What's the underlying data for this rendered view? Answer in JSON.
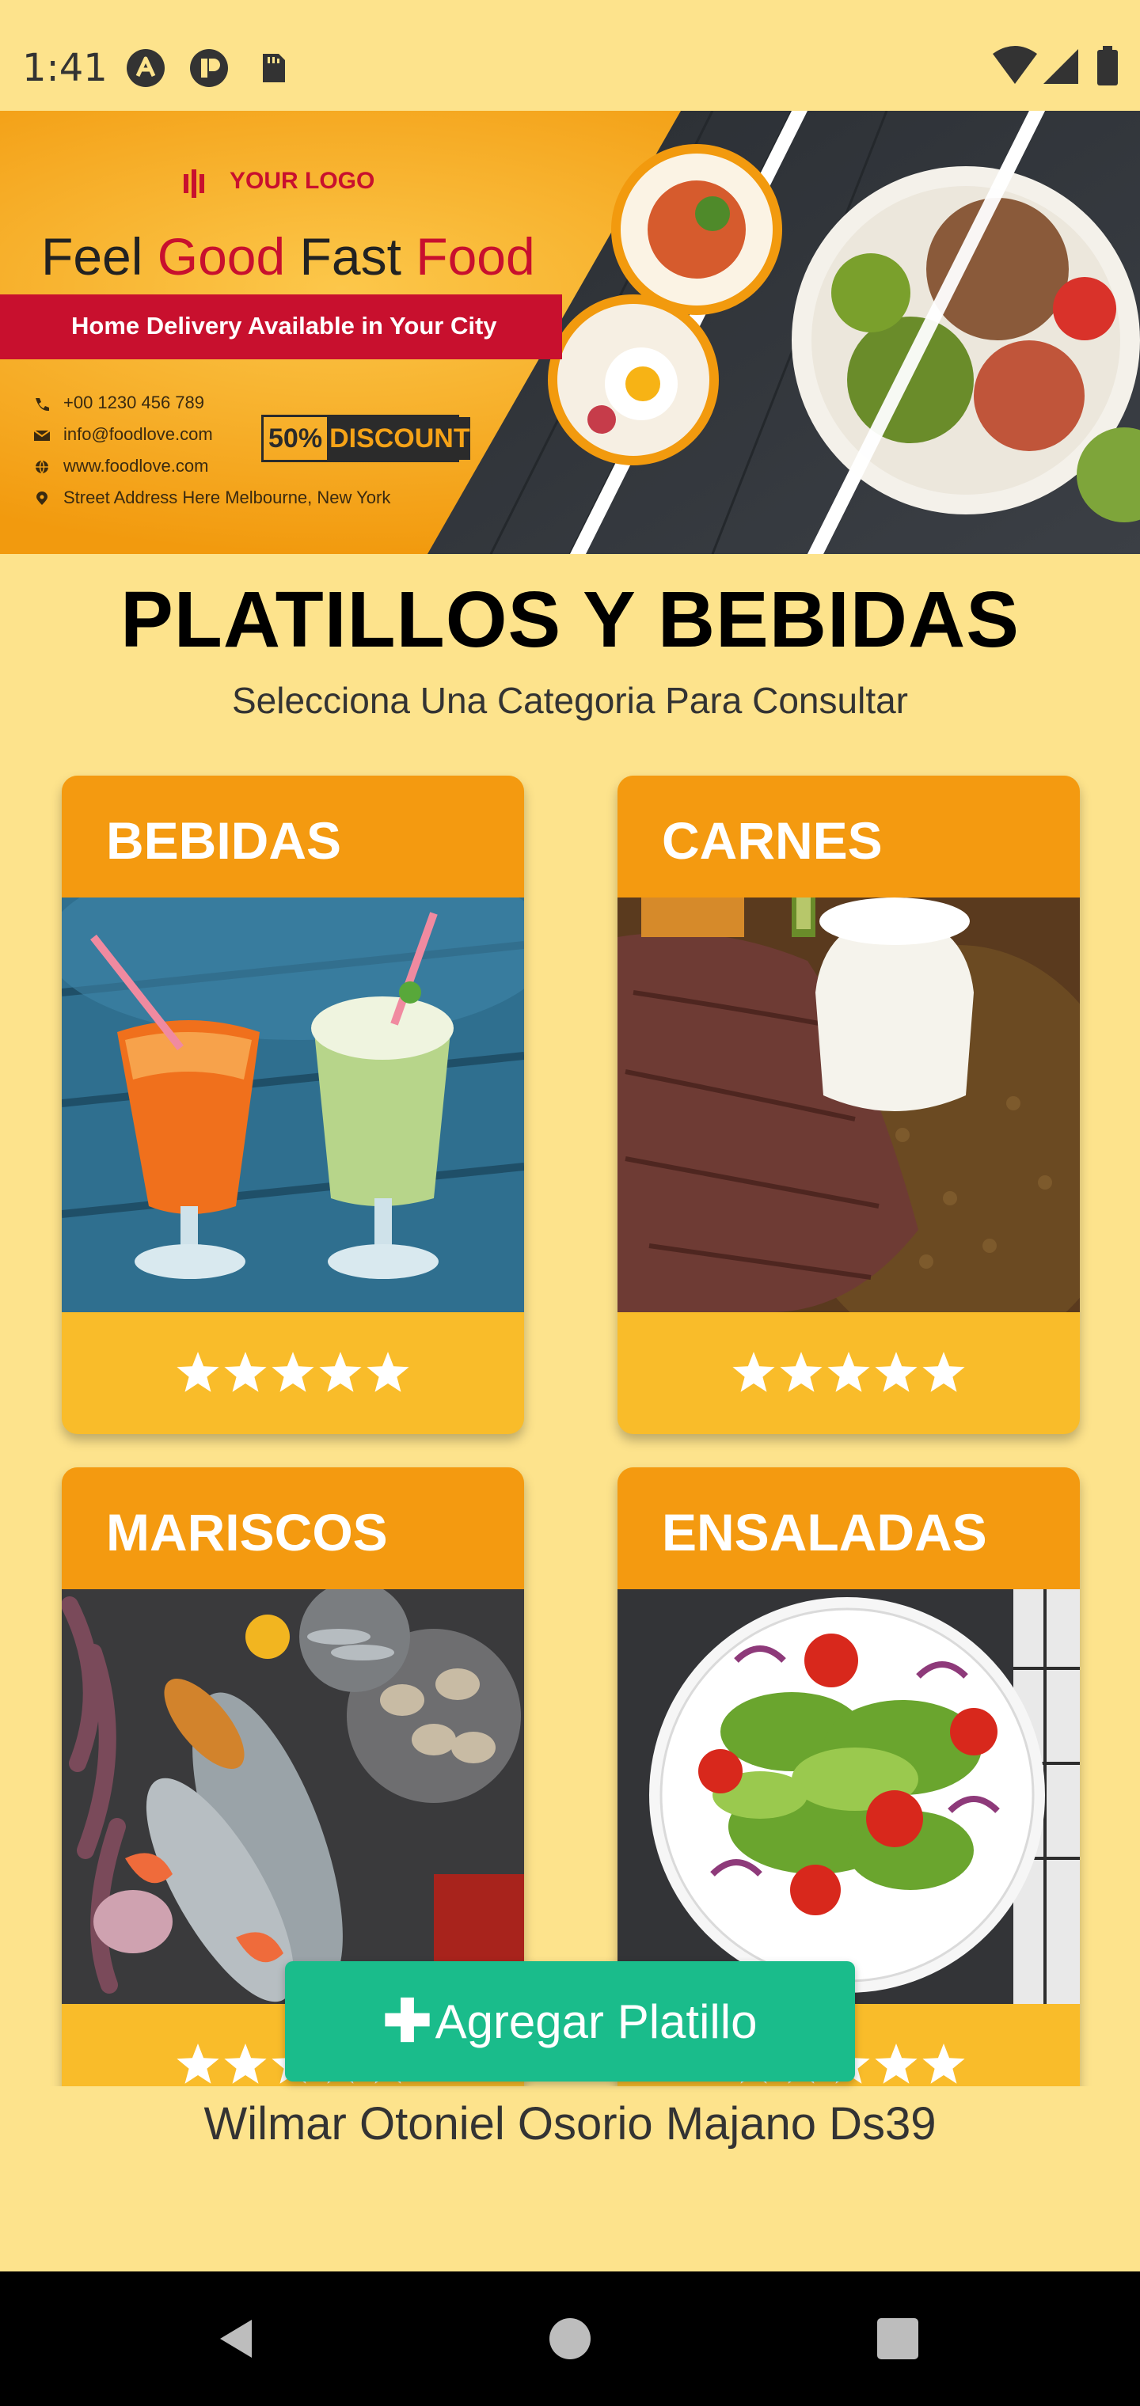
{
  "status_bar": {
    "time": "1:41",
    "left_icons": [
      "a-circle-icon",
      "play-protect-icon",
      "sd-card-icon"
    ],
    "right_icons": [
      "wifi-icon",
      "signal-icon",
      "battery-icon"
    ]
  },
  "banner": {
    "logo_text": "YOUR LOGO",
    "headline_word_1": "Feel",
    "headline_word_2": "Good",
    "headline_word_3": "Fast",
    "headline_word_4": "Food",
    "ribbon_text": "Home Delivery Available in Your City",
    "contacts": [
      {
        "icon": "phone-icon",
        "text": "+00 1230 456 789"
      },
      {
        "icon": "mail-icon",
        "text": "info@foodlove.com"
      },
      {
        "icon": "globe-icon",
        "text": "www.foodlove.com"
      },
      {
        "icon": "location-icon",
        "text": "Street Address Here Melbourne, New York"
      }
    ],
    "discount_pct": "50%",
    "discount_label": "DISCOUNT"
  },
  "page": {
    "title": "PLATILLOS Y BEBIDAS",
    "subtitle": "Selecciona Una Categoria Para Consultar"
  },
  "categories": [
    {
      "title": "BEBIDAS",
      "rating": 5,
      "image": "drinks-photo"
    },
    {
      "title": "CARNES",
      "rating": 5,
      "image": "meat-photo"
    },
    {
      "title": "MARISCOS",
      "rating": 5,
      "image": "seafood-photo"
    },
    {
      "title": "ENSALADAS",
      "rating": 5,
      "image": "salad-photo"
    }
  ],
  "add_button": {
    "icon": "plus-icon",
    "label": "Agregar Platillo"
  },
  "footer": {
    "author": "Wilmar Otoniel Osorio Majano Ds39"
  },
  "colors": {
    "background": "#FDE38C",
    "card_header": "#F49A10",
    "card_body": "#F9BC2A",
    "add_button": "#1ABC8B",
    "banner_red": "#C8102E"
  }
}
